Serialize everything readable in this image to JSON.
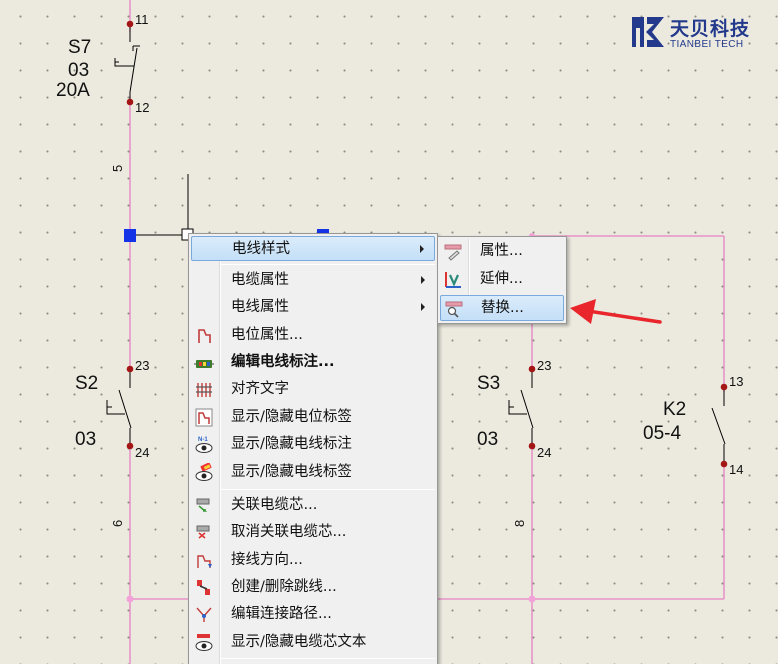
{
  "logo": {
    "name_cn": "天贝科技",
    "name_en": "TIANBEI TECH",
    "color": "#233a8c"
  },
  "schematic": {
    "wire_color": "#e782c4",
    "node_color": "#a41616",
    "components": [
      {
        "id": "s7",
        "name": "S7",
        "line2": "03",
        "line3": "20A",
        "pin_top": "11",
        "pin_bottom": "12"
      },
      {
        "id": "s2",
        "name": "S2",
        "value": "03",
        "pin_top": "23",
        "pin_bottom": "24"
      },
      {
        "id": "s3",
        "name": "S3",
        "value": "03",
        "pin_top": "23",
        "pin_bottom": "24"
      },
      {
        "id": "k2",
        "name": "K2",
        "value": "05-4",
        "pin_top": "13",
        "pin_bottom": "14"
      }
    ],
    "wire_numbers": [
      "5",
      "6",
      "8"
    ]
  },
  "context_menu": {
    "items": [
      {
        "label": "电线样式",
        "has_submenu": true,
        "highlighted": true,
        "icon": "none"
      },
      {
        "label": "电缆属性",
        "has_submenu": true,
        "icon": "none"
      },
      {
        "label": "电线属性",
        "has_submenu": true,
        "icon": "none"
      },
      {
        "label": "电位属性...",
        "icon": "potential-icon"
      },
      {
        "label": "编辑电线标注...",
        "bold": true,
        "icon": "wire-label-icon"
      },
      {
        "label": "对齐文字",
        "icon": "align-text-icon"
      },
      {
        "label": "显示/隐藏电位标签",
        "icon": "potential-tag-icon"
      },
      {
        "label": "显示/隐藏电线标注",
        "icon": "eye-n1-icon"
      },
      {
        "label": "显示/隐藏电线标签",
        "icon": "eye-tag-icon"
      },
      {
        "label": "关联电缆芯...",
        "icon": "link-core-icon"
      },
      {
        "label": "取消关联电缆芯...",
        "icon": "unlink-core-icon"
      },
      {
        "label": "接线方向...",
        "icon": "wiring-direction-icon"
      },
      {
        "label": "创建/删除跳线...",
        "icon": "jumper-icon"
      },
      {
        "label": "编辑连接路径...",
        "icon": "connection-path-icon"
      },
      {
        "label": "显示/隐藏电缆芯文本",
        "icon": "eye-core-text-icon"
      }
    ]
  },
  "submenu": {
    "items": [
      {
        "label": "属性...",
        "icon": "properties-icon"
      },
      {
        "label": "延伸...",
        "icon": "extend-icon"
      },
      {
        "label": "替换...",
        "icon": "replace-icon",
        "highlighted": true
      }
    ]
  },
  "annotation": {
    "arrow_color": "#e8262b"
  }
}
